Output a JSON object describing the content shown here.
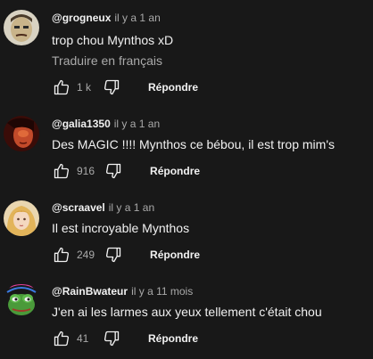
{
  "comments": [
    {
      "handle": "@grogneux",
      "time": "il y a 1 an",
      "text": "trop chou Mynthos xD",
      "translate": "Traduire en français",
      "likes": "1 k",
      "reply": "Répondre",
      "avatar": "avatar-cartoon-face"
    },
    {
      "handle": "@galia1350",
      "time": "il y a 1 an",
      "text": "Des MAGIC !!!! Mynthos ce bébou, il est trop mim's",
      "likes": "916",
      "reply": "Répondre",
      "avatar": "avatar-red-portrait"
    },
    {
      "handle": "@scraavel",
      "time": "il y a 1 an",
      "text": "Il est incroyable Mynthos",
      "likes": "249",
      "reply": "Répondre",
      "avatar": "avatar-blonde-girl"
    },
    {
      "handle": "@RainBwateur",
      "time": "il y a 11 mois",
      "text": "J'en ai les larmes aux yeux tellement c'était chou",
      "likes": "41",
      "reply": "Répondre",
      "avatar": "avatar-green-frog"
    }
  ],
  "colors": {
    "background": "#181818",
    "text_primary": "#f1f1f1",
    "text_secondary": "#aaaaaa"
  }
}
